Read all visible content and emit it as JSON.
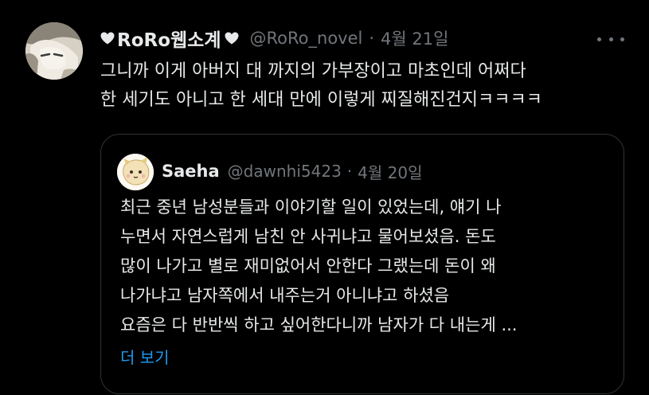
{
  "tweet": {
    "author": {
      "display_name": "RoRo웹소계",
      "handle": "@RoRo_novel",
      "heart_icon": "black-heart-icon"
    },
    "separator": "·",
    "date": "4월 21일",
    "more_icon": "more-options-icon",
    "text_lines": [
      "그니까 이게 아버지 대 까지의 가부장이고 마초인데 어쩌다",
      "한 세기도 아니고 한 세대 만에 이렇게 찌질해진건지ㅋㅋㅋㅋ"
    ]
  },
  "quoted_tweet": {
    "author": {
      "display_name": "Saeha",
      "handle": "@dawnhi5423"
    },
    "separator": "·",
    "date": "4월 20일",
    "text_lines": [
      "최근 중년 남성분들과 이야기할 일이 있었는데, 얘기 나",
      "누면서 자연스럽게 남친 안 사귀냐고 물어보셨음. 돈도",
      "많이 나가고 별로 재미없어서 안한다 그랬는데 돈이 왜",
      "나가냐고 남자쪽에서 내주는거 아니냐고 하셨음",
      "요즘은 다 반반씩 하고 싶어한다니까 남자가 다 내는게 ..."
    ],
    "show_more_label": "더 보기"
  },
  "colors": {
    "background": "#000000",
    "primary_text": "#e7e9ea",
    "secondary_text": "#71767b",
    "border": "#2f3336",
    "link": "#1d9bf0"
  }
}
